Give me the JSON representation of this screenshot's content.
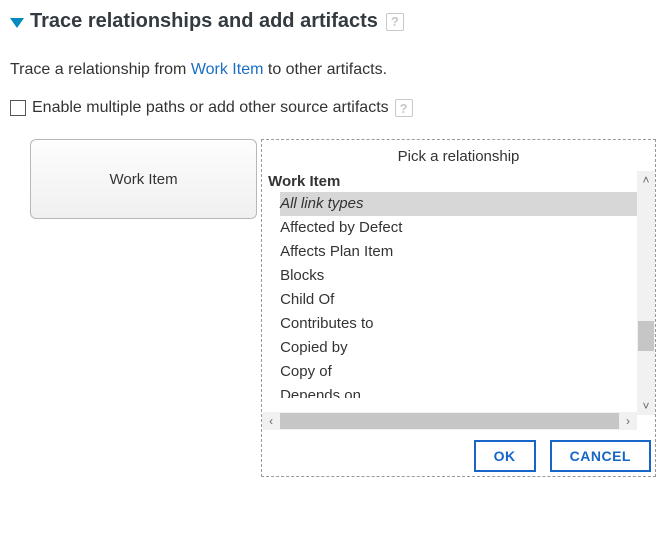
{
  "header": {
    "title": "Trace relationships and add artifacts",
    "help_glyph": "?"
  },
  "intro": {
    "prefix": "Trace a relationship from ",
    "link": "Work Item",
    "suffix": " to other artifacts."
  },
  "checkbox": {
    "label": "Enable multiple paths or add other source artifacts",
    "help_glyph": "?"
  },
  "source": {
    "label": "Work Item"
  },
  "picker": {
    "title": "Pick a relationship",
    "group": "Work Item",
    "items": [
      "All link types",
      "Affected by Defect",
      "Affects Plan Item",
      "Blocks",
      "Child Of",
      "Contributes to",
      "Copied by",
      "Copy of",
      "Depends on"
    ],
    "selected_index": 0
  },
  "buttons": {
    "ok": "OK",
    "cancel": "CANCEL"
  },
  "scroll_glyphs": {
    "up": "˄",
    "down": "˅",
    "left": "‹",
    "right": "›"
  }
}
